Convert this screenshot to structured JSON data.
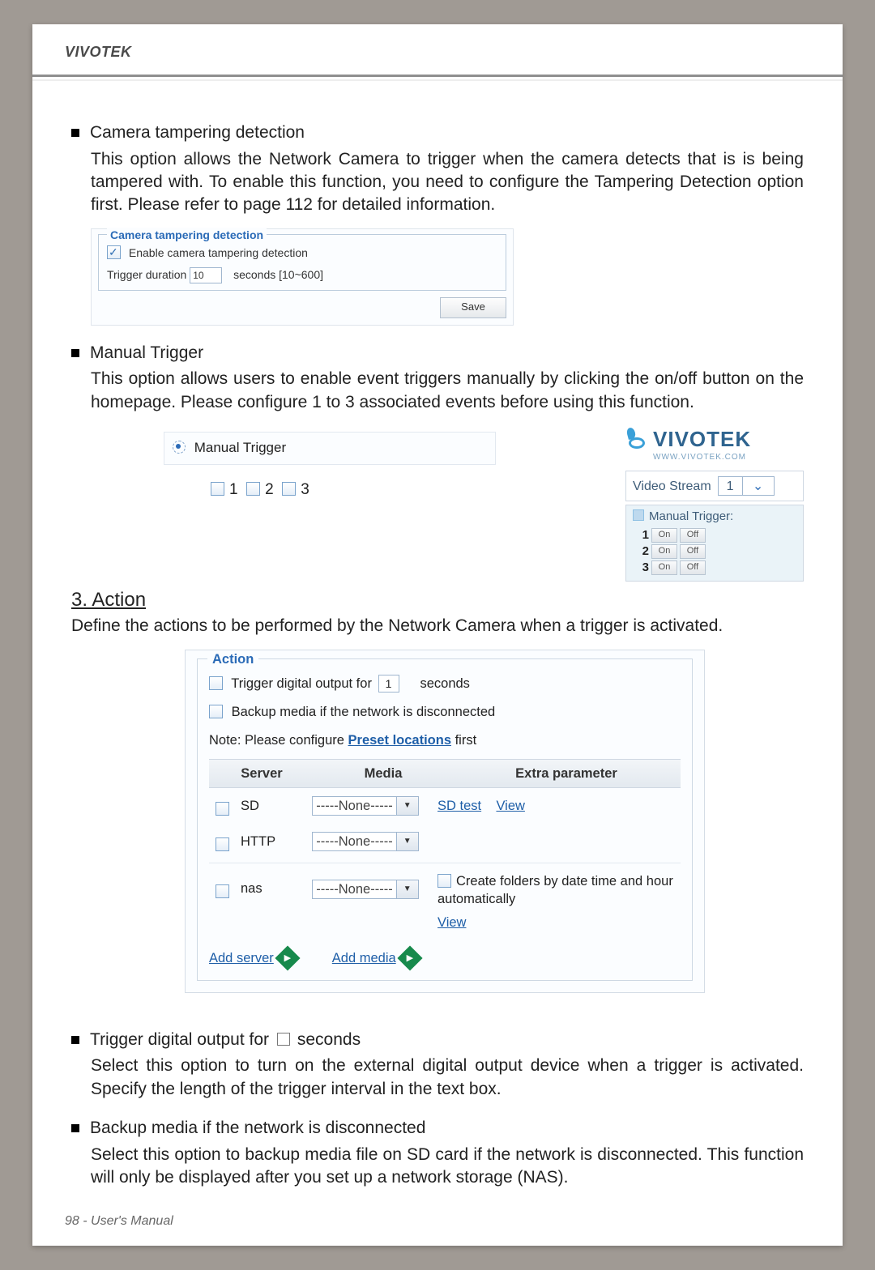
{
  "brand": "VIVOTEK",
  "section1": {
    "title": "Camera tampering detection",
    "body": "This option allows the Network Camera to trigger when the camera detects that is is being tampered with. To enable this function, you need to configure the Tampering Detection option first. Please refer to page 112 for detailed information.",
    "panel": {
      "legend": "Camera tampering detection",
      "enable": "Enable camera tampering detection",
      "trigdur_label": "Trigger duration",
      "trigdur_value": "10",
      "trigdur_suffix": "seconds [10~600]",
      "save": "Save"
    }
  },
  "section2": {
    "title": "Manual Trigger",
    "body": "This option allows users to enable event triggers manually by clicking the on/off button on the homepage. Please configure 1 to 3 associated events before using this function.",
    "label": "Manual Trigger",
    "opts": [
      "1",
      "2",
      "3"
    ]
  },
  "vside": {
    "logo": "VIVOTEK",
    "url": "WWW.VIVOTEK.COM",
    "vs_label": "Video Stream",
    "vs_value": "1",
    "mt_title": "Manual Trigger:",
    "rows": [
      {
        "n": "1",
        "on": "On",
        "off": "Off"
      },
      {
        "n": "2",
        "on": "On",
        "off": "Off"
      },
      {
        "n": "3",
        "on": "On",
        "off": "Off"
      }
    ]
  },
  "action": {
    "heading": "3. Action",
    "intro": "Define the actions to be performed by the Network Camera when a trigger is activated.",
    "legend": "Action",
    "trig_pre": "Trigger digital output for",
    "trig_value": "1",
    "trig_post": "seconds",
    "backup": "Backup media if the network is disconnected",
    "note_pre": "Note: Please configure ",
    "note_link": "Preset locations",
    "note_post": " first",
    "headers": {
      "server": "Server",
      "media": "Media",
      "extra": "Extra parameter"
    },
    "rows": [
      {
        "server": "SD",
        "media": "-----None-----",
        "extra1": "SD test",
        "extra2": "View"
      },
      {
        "server": "HTTP",
        "media": "-----None-----"
      },
      {
        "server": "nas",
        "media": "-----None-----",
        "extra_top": "Create folders by date time and hour automatically",
        "extra_bottom": "View"
      }
    ],
    "add_server": "Add server",
    "add_media": "Add media"
  },
  "section3": {
    "title_pre": "Trigger digital output for ",
    "title_post": " seconds",
    "body": "Select this option to turn on the external digital output device when a trigger is activated. Specify the length of the trigger interval in the text box."
  },
  "section4": {
    "title": "Backup media if the network is disconnected",
    "body": "Select this option to backup media file on SD card if the network is disconnected. This function will only be displayed after you set up a network storage (NAS)."
  },
  "footer": "98 - User's Manual"
}
